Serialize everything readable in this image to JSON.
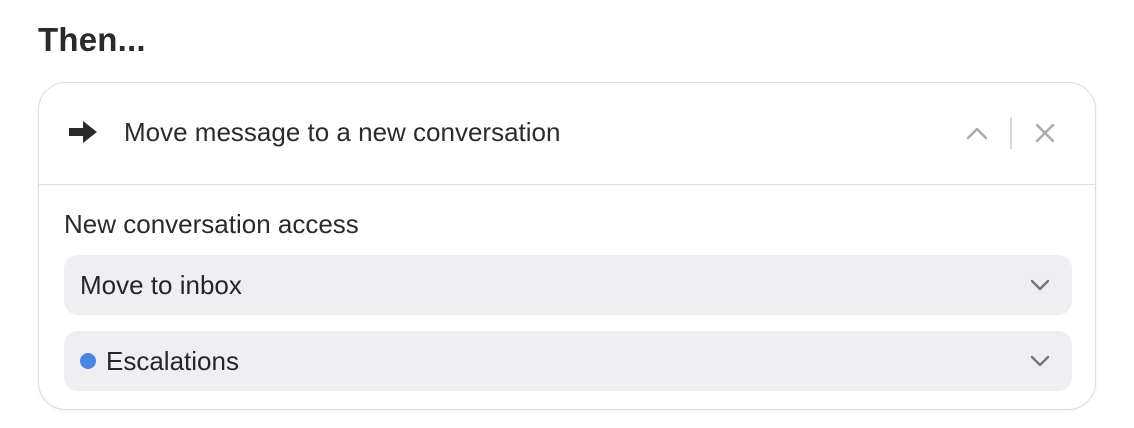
{
  "heading": "Then...",
  "action_card": {
    "title": "Move message to a new conversation",
    "icon": "arrow-right-icon",
    "collapse_icon": "chevron-up-icon",
    "close_icon": "close-icon",
    "access_label": "New conversation access",
    "access_select": {
      "value": "Move to inbox",
      "icon": "chevron-down-icon"
    },
    "inbox_select": {
      "value": "Escalations",
      "dot_color": "#4a86e0",
      "icon": "chevron-down-icon"
    }
  }
}
